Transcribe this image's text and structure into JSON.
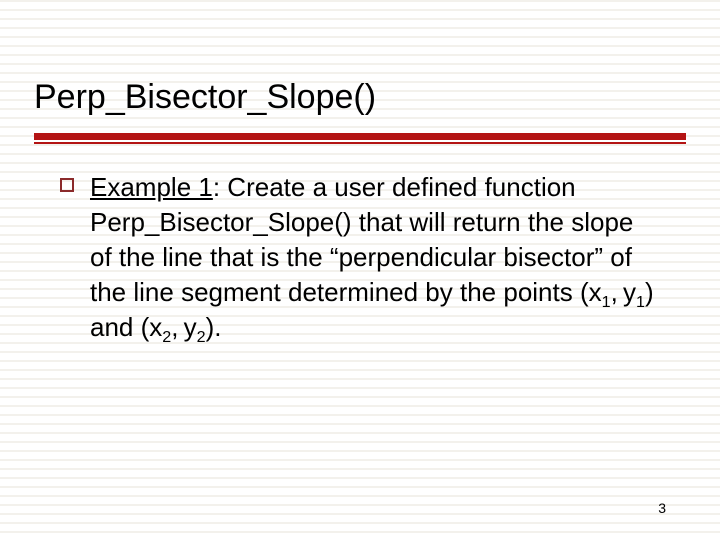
{
  "title": "Perp_Bisector_Slope()",
  "body": {
    "example_label": "Example 1",
    "sep": ":",
    "text_after": "  Create a user defined function Perp_Bisector_Slope() that will return the slope of the line that is the “perpendicular bisector” of the line segment determined by the points (x",
    "sub1a": "1",
    "between1": ", y",
    "sub1b": "1",
    "mid": ") and (x",
    "sub2a": "2",
    "between2": ", y",
    "sub2b": "2",
    "end": ")."
  },
  "page_number": "3"
}
